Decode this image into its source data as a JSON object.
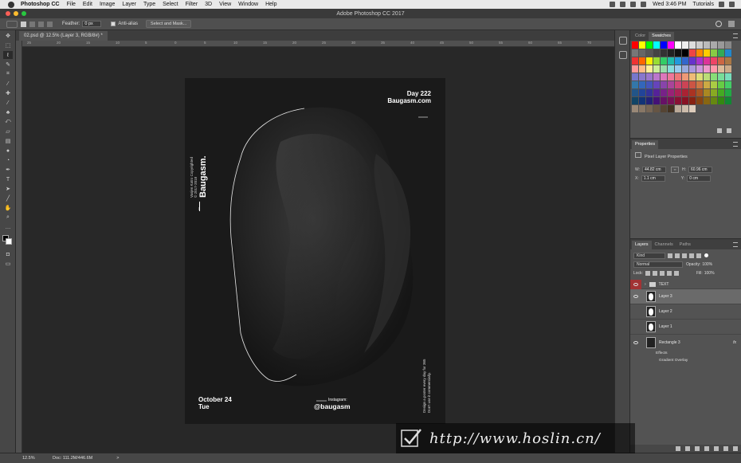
{
  "menubar": {
    "app": "Photoshop CC",
    "items": [
      "File",
      "Edit",
      "Image",
      "Layer",
      "Type",
      "Select",
      "Filter",
      "3D",
      "View",
      "Window",
      "Help"
    ],
    "clock": "Wed 3:46 PM",
    "user": "Tutorials"
  },
  "window": {
    "title": "Adobe Photoshop CC 2017"
  },
  "options": {
    "feather_label": "Feather:",
    "feather_value": "0 px",
    "antialias_label": "Anti-alias",
    "select_mask": "Select and Mask..."
  },
  "document": {
    "tab": "02.psd @ 12.5% (Layer 3, RGB/8#) *",
    "ruler_ticks": [
      "25",
      "20",
      "15",
      "10",
      "5",
      "0",
      "5",
      "10",
      "15",
      "20",
      "25",
      "30",
      "35",
      "40",
      "45",
      "50",
      "55",
      "60",
      "65",
      "70"
    ]
  },
  "poster": {
    "day": "Day 222",
    "site": "Baugasm.com",
    "brand": "Baugasm.",
    "copyright_line1": "Vasjen Katro Copyrighted",
    "copyright_line2": "© 2017-2018",
    "date": "October 24",
    "weekday": "Tue",
    "instagram_label": "Instagram:",
    "instagram_handle": "@baugasm",
    "side_line1": "Design a poster every day for 365",
    "side_line2": "Don't use it commercially."
  },
  "status": {
    "zoom": "12.5%",
    "doc": "Doc: 111.2M/446.6M",
    "arrow": ">"
  },
  "panels": {
    "color_tabs": [
      "Color",
      "Swatches"
    ],
    "swatch_rows": [
      [
        "#ff0000",
        "#ffff00",
        "#00ff00",
        "#00ffff",
        "#0000ff",
        "#ff00ff",
        "#ffffff",
        "#eeeeee",
        "#dddddd",
        "#cccccc",
        "#bbbbbb",
        "#aaaaaa",
        "#999999",
        "#888888"
      ],
      [
        "#777777",
        "#666666",
        "#555555",
        "#444444",
        "#333333",
        "#222222",
        "#111111",
        "#000000",
        "#ee4444",
        "#ff8800",
        "#ffcc00",
        "#88cc44",
        "#33aa55",
        "#2288cc"
      ],
      [
        "#ee3333",
        "#ff6600",
        "#ffee00",
        "#99dd33",
        "#33cc66",
        "#22bbaa",
        "#2299dd",
        "#3366cc",
        "#6633cc",
        "#aa33cc",
        "#dd3399",
        "#ee4466",
        "#cc6644",
        "#aa7744"
      ],
      [
        "#ff9999",
        "#ffbb88",
        "#ffee99",
        "#ccee99",
        "#99ddaa",
        "#88dddd",
        "#99ccee",
        "#99aadd",
        "#aa99dd",
        "#cc99dd",
        "#ee99cc",
        "#ff99aa",
        "#ddbb99",
        "#ccaa88"
      ],
      [
        "#7777cc",
        "#8877cc",
        "#9977cc",
        "#bb77cc",
        "#dd77bb",
        "#ee7799",
        "#ee7777",
        "#ee9977",
        "#eebb77",
        "#dddd77",
        "#bbdd77",
        "#88dd77",
        "#77dd99",
        "#77ddbb"
      ],
      [
        "#3377aa",
        "#3366bb",
        "#4455bb",
        "#6644bb",
        "#8844aa",
        "#aa4499",
        "#cc4477",
        "#cc4455",
        "#cc5544",
        "#cc7744",
        "#ccaa44",
        "#aacc44",
        "#66cc44",
        "#44cc66"
      ],
      [
        "#225588",
        "#224499",
        "#333399",
        "#552299",
        "#772288",
        "#992277",
        "#aa2255",
        "#aa2233",
        "#aa3322",
        "#aa5522",
        "#aa8822",
        "#88aa22",
        "#44aa22",
        "#22aa44"
      ],
      [
        "#114466",
        "#113377",
        "#222277",
        "#441177",
        "#661166",
        "#771155",
        "#881133",
        "#881122",
        "#882211",
        "#884411",
        "#886611",
        "#668811",
        "#338811",
        "#118833"
      ],
      [
        "#998877",
        "#887766",
        "#776655",
        "#665544",
        "#554433",
        "#443322",
        "#bbaa99",
        "#ccbbaa",
        "#ddccbb"
      ]
    ],
    "properties_title": "Properties",
    "pixel_layer": "Pixel Layer Properties",
    "w_label": "W:",
    "w_value": "44.82 cm",
    "h_label": "H:",
    "h_value": "60.96 cm",
    "x_label": "X:",
    "x_value": "1.1 cm",
    "y_label": "Y:",
    "y_value": "0 cm",
    "layers_tabs": [
      "Layers",
      "Channels",
      "Paths"
    ],
    "kind": "Kind",
    "blend_mode": "Normal",
    "opacity_label": "Opacity:",
    "opacity_value": "100%",
    "lock_label": "Lock:",
    "fill_label": "Fill:",
    "fill_value": "100%",
    "layers": [
      {
        "name": "TEXT",
        "type": "group"
      },
      {
        "name": "Layer 3",
        "type": "pixel",
        "selected": true
      },
      {
        "name": "Layer 2",
        "type": "pixel"
      },
      {
        "name": "Layer 1",
        "type": "pixel"
      },
      {
        "name": "Rectangle 3",
        "type": "shape",
        "fx": "fx"
      }
    ],
    "effects_label": "Effects",
    "effect_name": "Gradient Overlay"
  },
  "watermark": {
    "text": "http://www.hoslin.cn/"
  }
}
